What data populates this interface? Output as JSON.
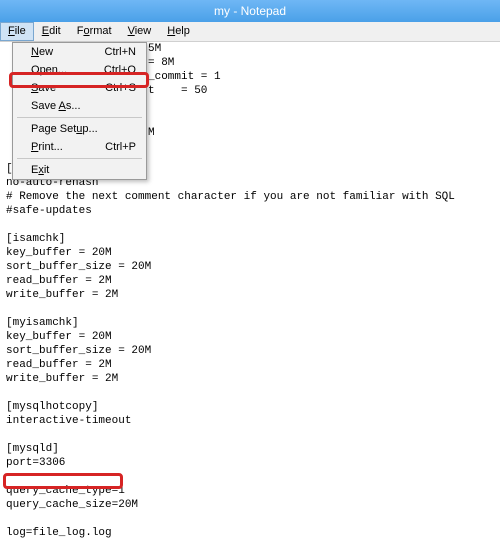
{
  "window": {
    "title": "my - Notepad"
  },
  "menubar": {
    "items": [
      {
        "label": "File",
        "hotkey": "F"
      },
      {
        "label": "Edit",
        "hotkey": "E"
      },
      {
        "label": "Format",
        "hotkey": "o"
      },
      {
        "label": "View",
        "hotkey": "V"
      },
      {
        "label": "Help",
        "hotkey": "H"
      }
    ]
  },
  "dropdown": {
    "items": [
      {
        "label": "New",
        "shortcut": "Ctrl+N"
      },
      {
        "label": "Open...",
        "shortcut": "Ctrl+O"
      },
      {
        "label": "Save",
        "shortcut": "Ctrl+S"
      },
      {
        "label": "Save As...",
        "shortcut": ""
      },
      {
        "sep": true
      },
      {
        "label": "Page Setup...",
        "shortcut": ""
      },
      {
        "label": "Print...",
        "shortcut": "Ctrl+P"
      },
      {
        "sep": true
      },
      {
        "label": "Exit",
        "shortcut": ""
      }
    ]
  },
  "fragment": "5M\n= 8M\n_commit = 1\nt    = 50\n\n\nM",
  "content": "[mysql]\nno-auto-rehash\n# Remove the next comment character if you are not familiar with SQL\n#safe-updates\n\n[isamchk]\nkey_buffer = 20M\nsort_buffer_size = 20M\nread_buffer = 2M\nwrite_buffer = 2M\n\n[myisamchk]\nkey_buffer = 20M\nsort_buffer_size = 20M\nread_buffer = 2M\nwrite_buffer = 2M\n\n[mysqlhotcopy]\ninteractive-timeout\n\n[mysqld]\nport=3306\n\nquery_cache_type=1\nquery_cache_size=20M\n\nlog=file_log.log"
}
